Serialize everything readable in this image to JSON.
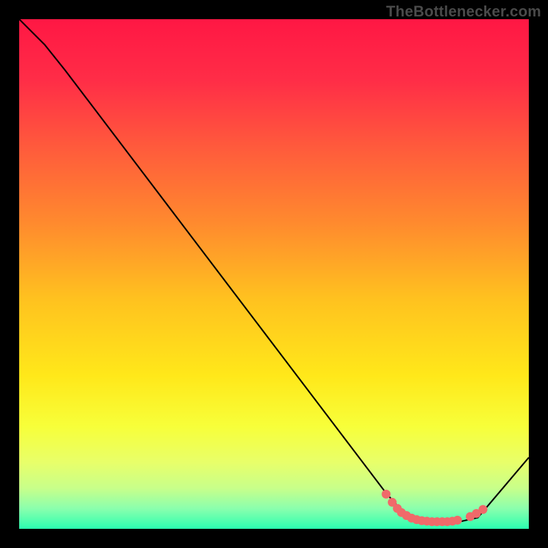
{
  "watermark": "TheBottlenecker.com",
  "chart_data": {
    "type": "line",
    "title": "",
    "xlabel": "",
    "ylabel": "",
    "xlim": [
      0,
      100
    ],
    "ylim": [
      0,
      100
    ],
    "series": [
      {
        "name": "curve",
        "points": [
          [
            0,
            100
          ],
          [
            5,
            95
          ],
          [
            9,
            90
          ],
          [
            72,
            7
          ],
          [
            76,
            2.5
          ],
          [
            80,
            1.3
          ],
          [
            86,
            1.3
          ],
          [
            90,
            2.2
          ],
          [
            100,
            14
          ]
        ]
      }
    ],
    "markers": {
      "name": "highlight-dots",
      "points": [
        [
          72.0,
          6.8
        ],
        [
          73.2,
          5.2
        ],
        [
          74.2,
          4.0
        ],
        [
          75.0,
          3.2
        ],
        [
          76.0,
          2.6
        ],
        [
          77.0,
          2.1
        ],
        [
          78.0,
          1.8
        ],
        [
          79.0,
          1.6
        ],
        [
          80.0,
          1.5
        ],
        [
          81.0,
          1.4
        ],
        [
          82.0,
          1.4
        ],
        [
          83.0,
          1.4
        ],
        [
          84.0,
          1.4
        ],
        [
          85.0,
          1.5
        ],
        [
          86.0,
          1.7
        ],
        [
          88.5,
          2.4
        ],
        [
          89.7,
          3.0
        ],
        [
          91.0,
          3.8
        ]
      ]
    },
    "gradient_stops": [
      {
        "offset": 0.0,
        "color": "#ff1744"
      },
      {
        "offset": 0.12,
        "color": "#ff2d47"
      },
      {
        "offset": 0.25,
        "color": "#ff5a3c"
      },
      {
        "offset": 0.4,
        "color": "#ff8a2e"
      },
      {
        "offset": 0.55,
        "color": "#ffc21f"
      },
      {
        "offset": 0.7,
        "color": "#ffe81a"
      },
      {
        "offset": 0.8,
        "color": "#f7ff3a"
      },
      {
        "offset": 0.87,
        "color": "#e8ff6a"
      },
      {
        "offset": 0.92,
        "color": "#c8ff8a"
      },
      {
        "offset": 0.96,
        "color": "#8bffad"
      },
      {
        "offset": 1.0,
        "color": "#2bffb0"
      }
    ],
    "marker_color": "#f06a6a",
    "line_color": "#000000"
  }
}
